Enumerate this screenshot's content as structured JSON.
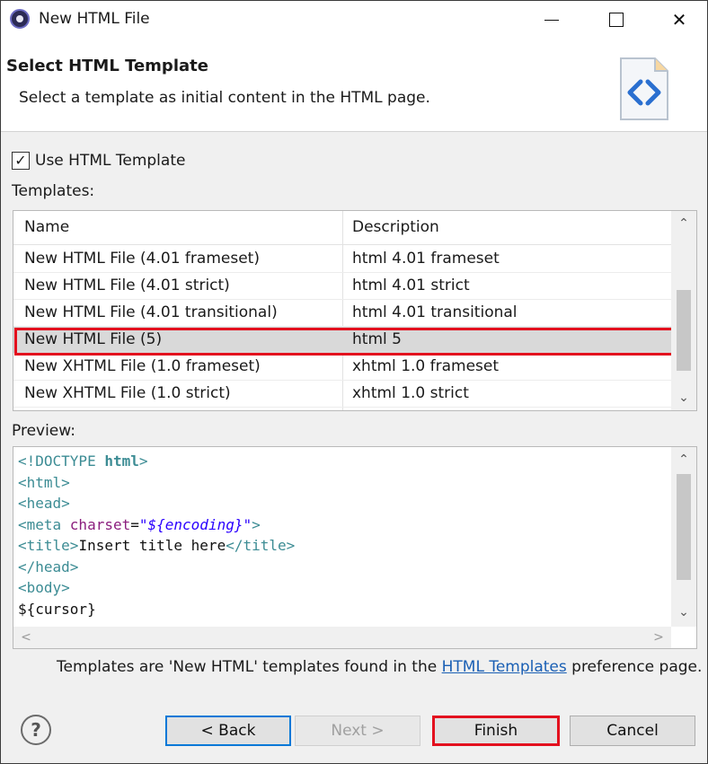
{
  "window": {
    "title": "New HTML File",
    "minimize_icon": "minimize-icon",
    "maximize_icon": "maximize-icon",
    "close_icon": "close-icon",
    "close_glyph": "✕"
  },
  "header": {
    "title": "Select HTML Template",
    "description": "Select a template as initial content in the HTML page.",
    "icon": "html-file-icon"
  },
  "use_template": {
    "label": "Use HTML Template",
    "checked": true,
    "check_glyph": "✓"
  },
  "templates": {
    "label": "Templates:",
    "columns": [
      "Name",
      "Description"
    ],
    "rows": [
      {
        "name": "New HTML File (4.01 frameset)",
        "description": "html 4.01 frameset"
      },
      {
        "name": "New HTML File (4.01 strict)",
        "description": "html 4.01 strict"
      },
      {
        "name": "New HTML File (4.01 transitional)",
        "description": "html 4.01 transitional"
      },
      {
        "name": "New HTML File (5)",
        "description": "html 5",
        "selected": true
      },
      {
        "name": "New XHTML File (1.0 frameset)",
        "description": "xhtml 1.0 frameset"
      },
      {
        "name": "New XHTML File (1.0 strict)",
        "description": "xhtml 1.0 strict"
      }
    ],
    "scroll_up_glyph": "⌃",
    "scroll_down_glyph": "⌄"
  },
  "preview": {
    "label": "Preview:",
    "code": {
      "l1_open": "<!DOCTYPE ",
      "l1_kw": "html",
      "l1_close": ">",
      "l2": "<html>",
      "l3": "<head>",
      "l4_tag": "<meta ",
      "l4_attr": "charset",
      "l4_eq": "=",
      "l4_str": "\"${encoding}\"",
      "l4_close": ">",
      "l5_open": "<title>",
      "l5_text": "Insert title here",
      "l5_close": "</title>",
      "l6": "</head>",
      "l7": "<body>",
      "l8": "${cursor}"
    },
    "hscroll_left_glyph": "<",
    "hscroll_right_glyph": ">"
  },
  "footer": {
    "note_before": "Templates are 'New HTML' templates found in the ",
    "note_link": "HTML Templates",
    "note_after": " preference page.",
    "help_glyph": "?"
  },
  "buttons": {
    "back": "< Back",
    "next": "Next >",
    "finish": "Finish",
    "cancel": "Cancel"
  },
  "colors": {
    "highlight_red": "#e3101e",
    "focus_blue": "#0078d7",
    "link_blue": "#1a5fb4"
  }
}
